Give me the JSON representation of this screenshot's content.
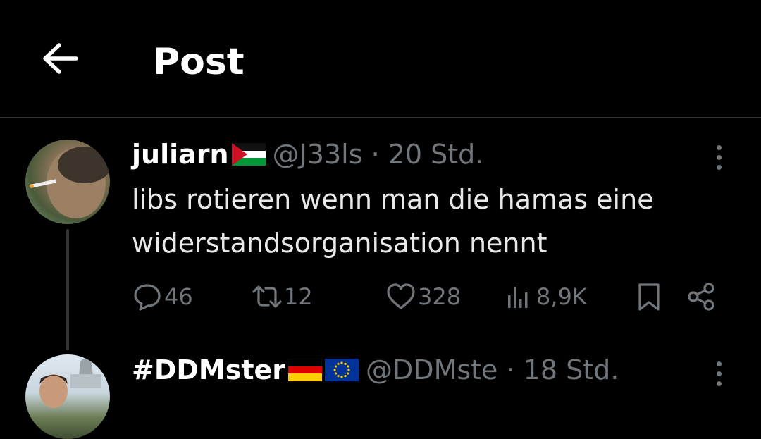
{
  "header": {
    "title": "Post"
  },
  "tweets": [
    {
      "display_name": "juliarn",
      "flags": [
        "palestine-flag"
      ],
      "handle_time": "@J33ls · 20 Std.",
      "text_line1": "libs rotieren wenn man die hamas eine",
      "text_line2": "widerstandsorganisation nennt",
      "replies": "46",
      "reposts": "12",
      "likes": "328",
      "views": "8,9K"
    },
    {
      "display_name": "#DDMster",
      "flags": [
        "germany-flag",
        "eu-flag"
      ],
      "handle_time": "@DDMste · 18 Std."
    }
  ],
  "colors": {
    "background": "#000000",
    "text": "#e7e9ea",
    "muted": "#71767b",
    "divider": "#2f3336"
  }
}
